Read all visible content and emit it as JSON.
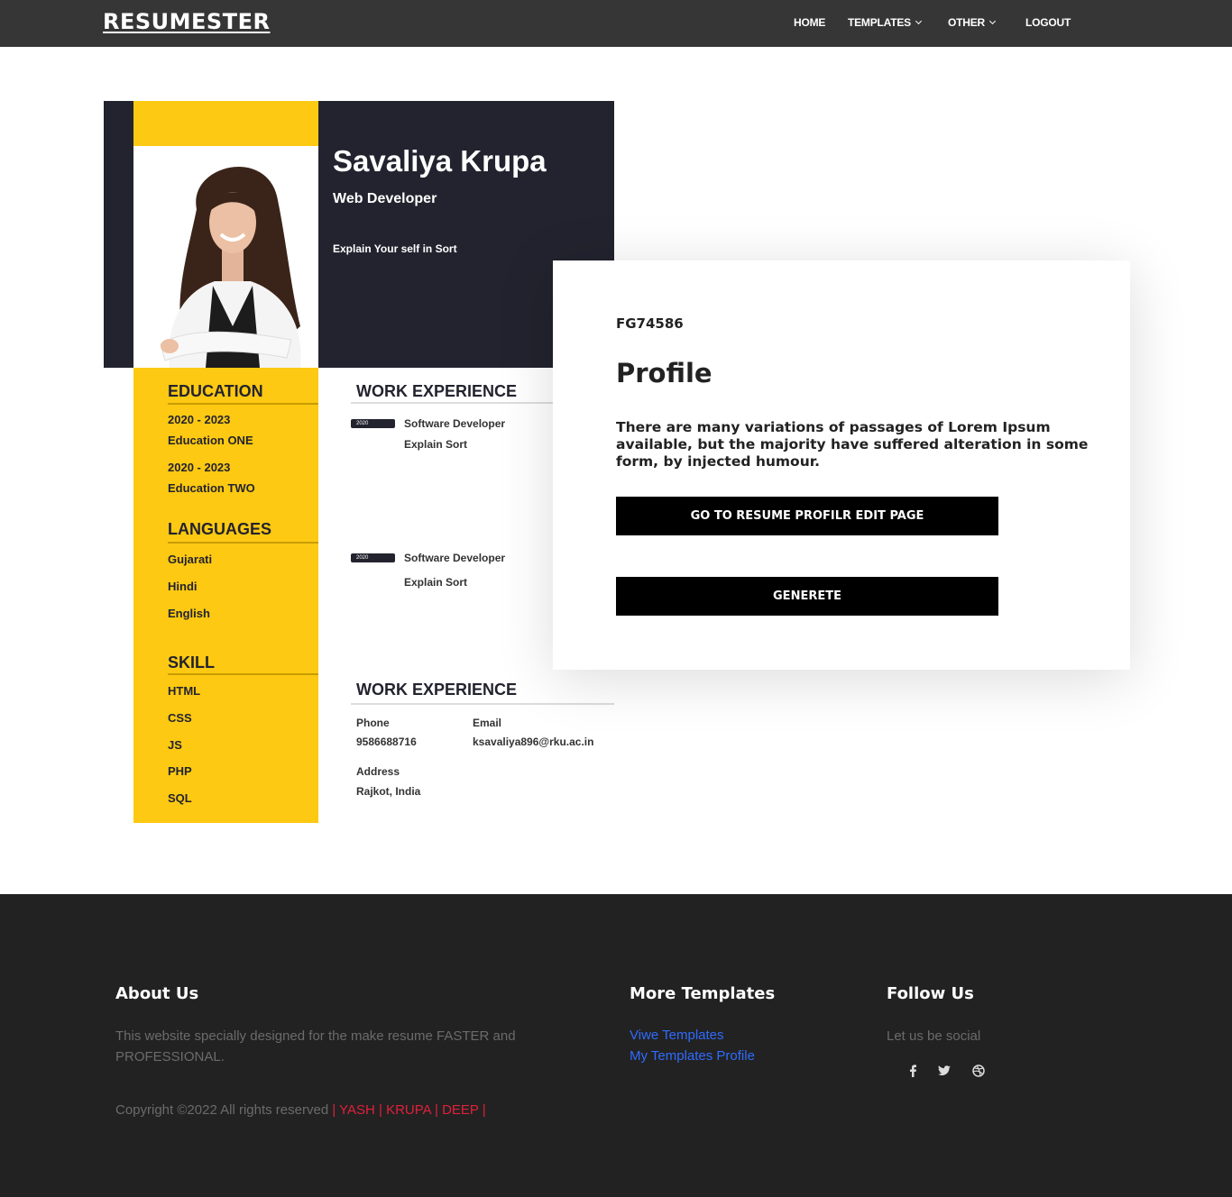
{
  "nav": {
    "brand": "RESUMESTER",
    "items": [
      "HOME",
      "TEMPLATES",
      "OTHER",
      "LOGOUT"
    ]
  },
  "resume": {
    "name": "Savaliya Krupa",
    "title": "Web Developer",
    "about": "Explain Your self in Sort",
    "education_heading": "EDUCATION",
    "education": [
      {
        "years": "2020 - 2023",
        "name": "Education ONE"
      },
      {
        "years": "2020 - 2023",
        "name": "Education TWO"
      }
    ],
    "languages_heading": "LANGUAGES",
    "languages": [
      "Gujarati",
      "Hindi",
      "English"
    ],
    "skill_heading": "SKILL",
    "skills": [
      "HTML",
      "CSS",
      "JS",
      "PHP",
      "SQL"
    ],
    "work_heading": "WORK EXPERIENCE",
    "work": [
      {
        "year": "2020",
        "role": "Software Developer",
        "desc": "Explain Sort"
      },
      {
        "year": "2020",
        "role": "Software Developer",
        "desc": "Explain Sort"
      }
    ],
    "contact_heading": "WORK EXPERIENCE",
    "phone_label": "Phone",
    "phone": "9586688716",
    "email_label": "Email",
    "email": "ksavaliya896@rku.ac.in",
    "address_label": "Address",
    "address": "Rajkot, India"
  },
  "profile": {
    "code": "FG74586",
    "heading": "Profile",
    "description": "There are many variations of passages of Lorem Ipsum available, but the majority have suffered alteration in some form, by injected humour.",
    "edit_button": "GO TO RESUME PROFILR EDIT PAGE",
    "generate_button": "GENERETE"
  },
  "footer": {
    "about_heading": "About Us",
    "about_text": "This website specially designed for the make resume FASTER and PROFESSIONAL.",
    "copyright": "Copyright ©2022 All rights reserved",
    "credits": " | YASH | KRUPA | DEEP |",
    "templates_heading": "More Templates",
    "links": [
      "Viwe Templates",
      "My Templates Profile"
    ],
    "follow_heading": "Follow Us",
    "follow_text": "Let us be social",
    "social_icons": [
      "facebook-icon",
      "twitter-icon",
      "dribbble-icon"
    ]
  },
  "colors": {
    "navbar": "#363636",
    "resume_dark": "#23232f",
    "resume_yellow": "#fdc912",
    "footer": "#222222",
    "link": "#2f6bff",
    "credits": "#e0203a"
  }
}
